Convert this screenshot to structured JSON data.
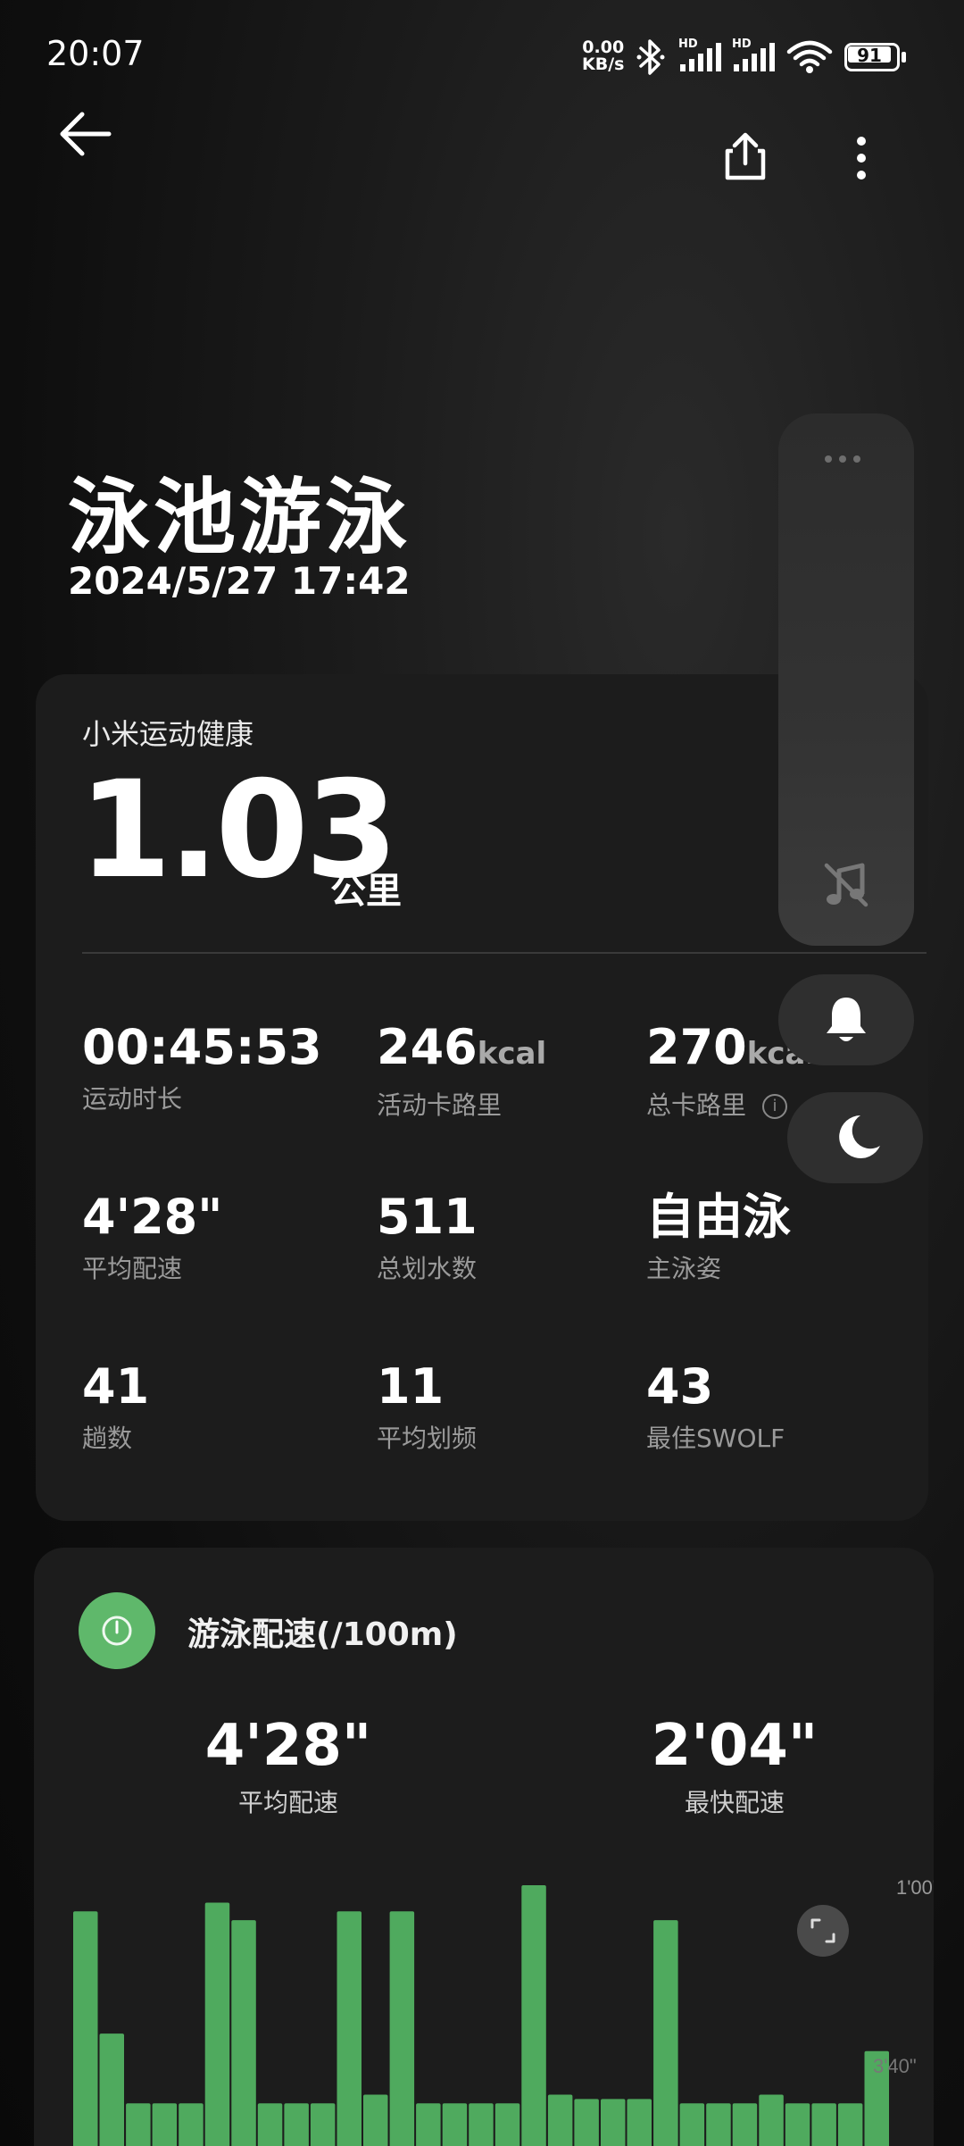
{
  "status_bar": {
    "time": "20:07",
    "net_speed_value": "0.00",
    "net_speed_unit": "KB/s",
    "hd_label": "HD",
    "battery": "91"
  },
  "workout": {
    "title": "泳池游泳",
    "datetime": "2024/5/27 17:42"
  },
  "summary": {
    "source": "小米运动健康",
    "distance": "1.03",
    "distance_unit": "公里",
    "stats": [
      {
        "value": "00:45:53",
        "unit": "",
        "label": "运动时长"
      },
      {
        "value": "246",
        "unit": "kcal",
        "label": "活动卡路里"
      },
      {
        "value": "270",
        "unit": "kcal",
        "label": "总卡路里"
      },
      {
        "value": "4'28\"",
        "unit": "",
        "label": "平均配速"
      },
      {
        "value": "511",
        "unit": "",
        "label": "总划水数"
      },
      {
        "value": "自由泳",
        "unit": "",
        "label": "主泳姿"
      },
      {
        "value": "41",
        "unit": "",
        "label": "趟数"
      },
      {
        "value": "11",
        "unit": "",
        "label": "平均划频"
      },
      {
        "value": "43",
        "unit": "",
        "label": "最佳SWOLF"
      }
    ]
  },
  "pace": {
    "title": "游泳配速(/100m)",
    "average_value": "4'28\"",
    "average_label": "平均配速",
    "fastest_value": "2'04\"",
    "fastest_label": "最快配速"
  },
  "chart_data": {
    "type": "bar",
    "ylabels": [
      "1'00\"",
      "3'40\""
    ],
    "bar_color": "#4faa5e",
    "values": [
      3.2,
      1.8,
      1.0,
      1.0,
      1.0,
      3.3,
      3.1,
      1.0,
      1.0,
      1.0,
      3.2,
      1.1,
      3.2,
      1.0,
      1.0,
      1.0,
      1.0,
      3.5,
      1.1,
      1.05,
      1.05,
      1.05,
      3.1,
      1.0,
      1.0,
      1.0,
      1.1,
      1.0,
      1.0,
      1.0,
      1.6
    ]
  }
}
